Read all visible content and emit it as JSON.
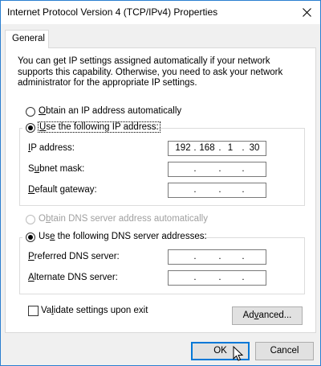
{
  "window": {
    "title": "Internet Protocol Version 4 (TCP/IPv4) Properties"
  },
  "tabs": [
    {
      "label": "General"
    }
  ],
  "intro_text": "You can get IP settings assigned automatically if your network supports this capability. Otherwise, you need to ask your network administrator for the appropriate IP settings.",
  "ip_section": {
    "auto_option": {
      "accel": "O",
      "rest": "btain an IP address automatically",
      "selected": false
    },
    "manual_option": {
      "accel": "U",
      "rest": "se the following IP address:",
      "selected": true
    },
    "fields": {
      "ip_address": {
        "accel": "I",
        "rest": "P address:",
        "octets": [
          "192",
          "168",
          "1",
          "30"
        ]
      },
      "subnet_mask": {
        "pre": "S",
        "accel": "u",
        "rest": "bnet mask:",
        "octets": [
          "",
          "",
          "",
          ""
        ]
      },
      "default_gateway": {
        "accel": "D",
        "rest": "efault gateway:",
        "octets": [
          "",
          "",
          "",
          ""
        ]
      }
    }
  },
  "dns_section": {
    "auto_option": {
      "pre": "O",
      "accel": "b",
      "rest": "tain DNS server address automatically",
      "selected": false,
      "enabled": false
    },
    "manual_option": {
      "pre": "Us",
      "accel": "e",
      "rest": " the following DNS server addresses:",
      "selected": true
    },
    "fields": {
      "preferred_dns": {
        "accel": "P",
        "rest": "referred DNS server:",
        "octets": [
          "",
          "",
          "",
          ""
        ]
      },
      "alternate_dns": {
        "accel": "A",
        "rest": "lternate DNS server:",
        "octets": [
          "",
          "",
          "",
          ""
        ]
      }
    }
  },
  "validate": {
    "pre": "Va",
    "accel": "l",
    "rest": "idate settings upon exit",
    "checked": false
  },
  "buttons": {
    "advanced": {
      "pre": "Ad",
      "accel": "v",
      "rest": "anced..."
    },
    "ok": "OK",
    "cancel": "Cancel"
  }
}
